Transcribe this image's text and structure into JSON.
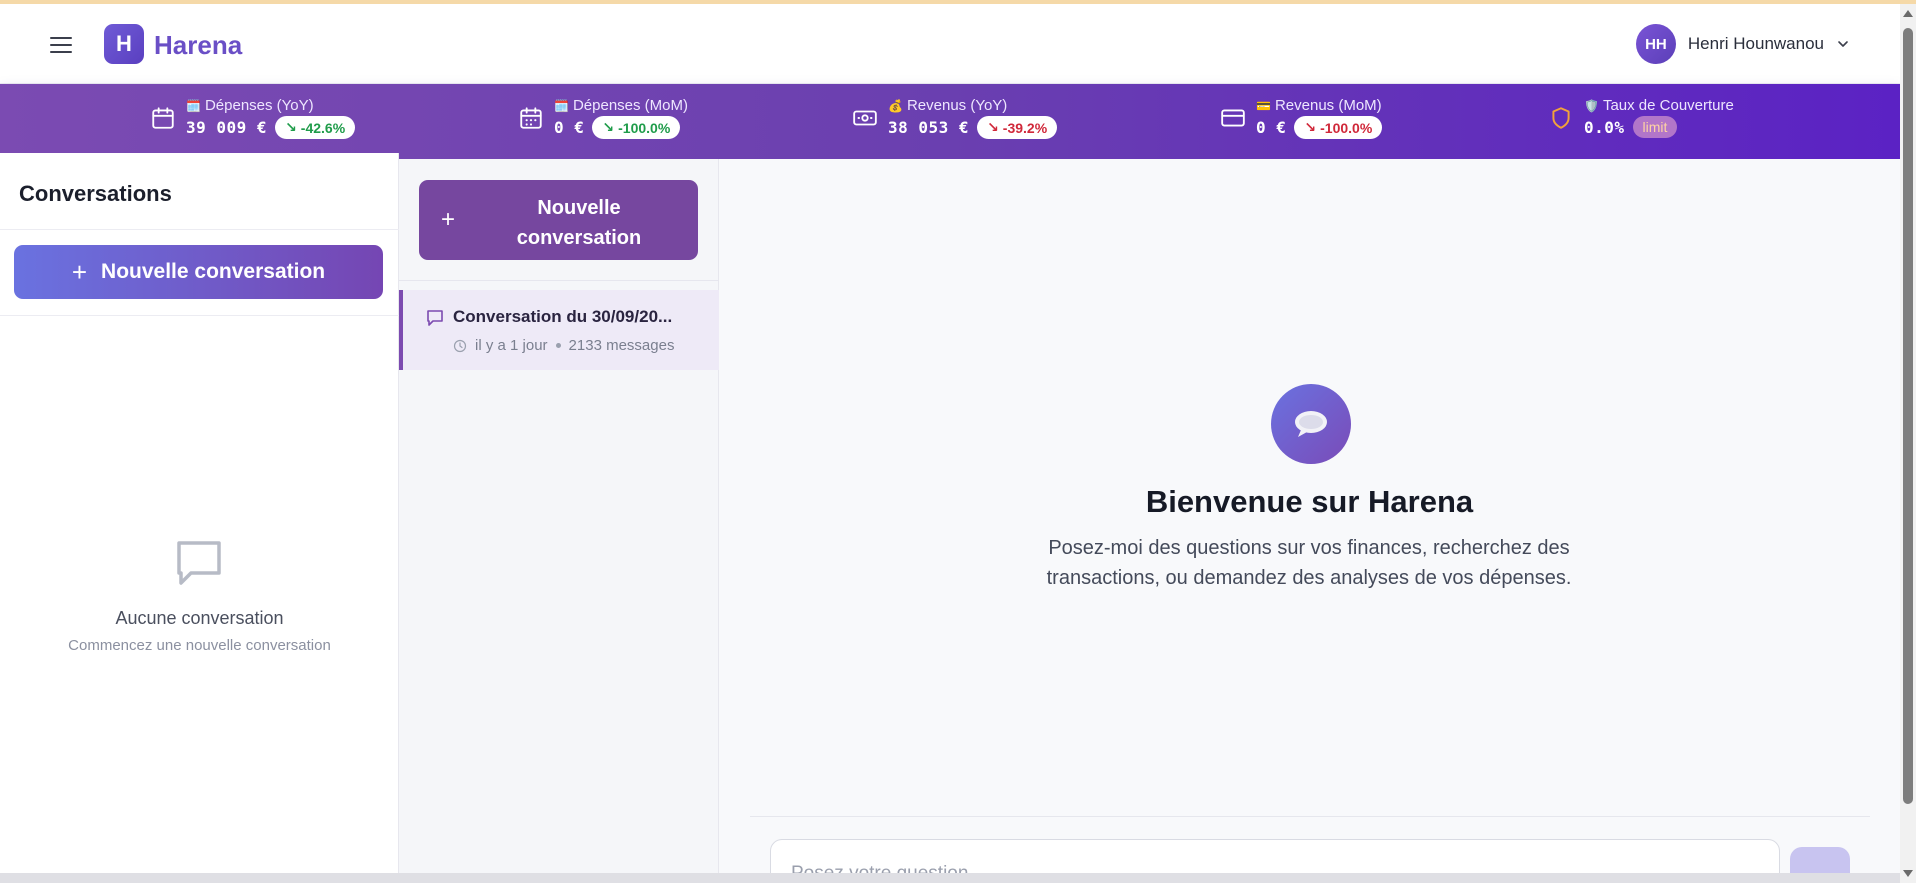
{
  "app": {
    "logo_letter": "H",
    "name": "Harena"
  },
  "user": {
    "initials": "HH",
    "name": "Henri Hounwanou"
  },
  "stats": [
    {
      "emoji": "🗓️",
      "label": "Dépenses (YoY)",
      "value": "39 009 €",
      "change": "-42.6%",
      "trend": "green"
    },
    {
      "emoji": "🗓️",
      "label": "Dépenses (MoM)",
      "value": "0 €",
      "change": "-100.0%",
      "trend": "green"
    },
    {
      "emoji": "💰",
      "label": "Revenus (YoY)",
      "value": "38 053 €",
      "change": "-39.2%",
      "trend": "red"
    },
    {
      "emoji": "💳",
      "label": "Revenus (MoM)",
      "value": "0 €",
      "change": "-100.0%",
      "trend": "red"
    },
    {
      "emoji": "🛡️",
      "label": "Taux de Couverture",
      "value": "0.0%",
      "change": "limit",
      "trend": "limit"
    }
  ],
  "sidebar": {
    "title": "Conversations",
    "new_button": "Nouvelle conversation",
    "empty_title": "Aucune conversation",
    "empty_subtitle": "Commencez une nouvelle conversation"
  },
  "conversations_panel": {
    "new_button": "Nouvelle conversation",
    "items": [
      {
        "title": "Conversation du 30/09/20...",
        "time": "il y a 1 jour",
        "count": "2133 messages"
      }
    ]
  },
  "main": {
    "welcome_title": "Bienvenue sur Harena",
    "welcome_text": "Posez-moi des questions sur vos finances, recherchez des transactions, ou demandez des analyses de vos dépenses.",
    "input_placeholder": "Posez votre question..."
  },
  "colors": {
    "accent": "#6a4fc6",
    "stats_bg": "#6a3fb0",
    "positive": "#1f9c4a",
    "negative": "#d0283a"
  },
  "icons": [
    "menu-icon",
    "chevron-down-icon",
    "calendar-icon",
    "cash-icon",
    "card-icon",
    "shield-icon",
    "plus-icon",
    "chat-bubble-icon",
    "clock-icon",
    "speech-bubble-icon",
    "send-icon"
  ]
}
